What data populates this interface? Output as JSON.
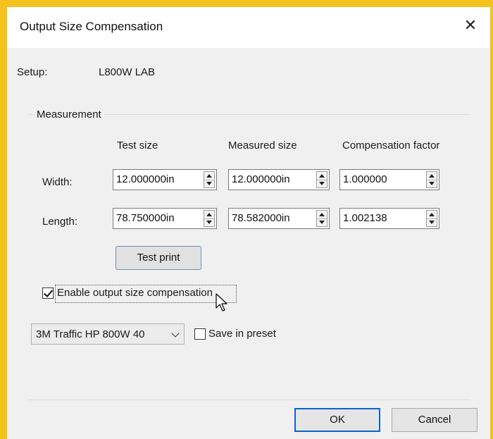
{
  "dialog": {
    "title": "Output Size Compensation",
    "close_glyph": "✕"
  },
  "setup": {
    "label": "Setup:",
    "value": "L800W LAB"
  },
  "measurement": {
    "group_label": "Measurement",
    "columns": [
      "Test size",
      "Measured size",
      "Compensation factor"
    ],
    "rows": [
      {
        "label": "Width:",
        "test_size": "12.000000in",
        "measured_size": "12.000000in",
        "factor": "1.000000"
      },
      {
        "label": "Length:",
        "test_size": "78.750000in",
        "measured_size": "78.582000in",
        "factor": "1.002138"
      }
    ],
    "test_print_label": "Test print"
  },
  "enable_compensation": {
    "label": "Enable output size compensation",
    "checked": true
  },
  "preset": {
    "selected": "3M Traffic HP 800W 40",
    "save_label": "Save in preset",
    "save_checked": false
  },
  "footer": {
    "ok_label": "OK",
    "cancel_label": "Cancel"
  },
  "colors": {
    "frame": "#f3c21c",
    "dialog_bg": "#f0f0f0",
    "focus_border": "#0a64c8"
  },
  "icons": {
    "close": "close-icon",
    "spin_up": "arrow-up-icon",
    "spin_down": "arrow-down-icon",
    "dropdown": "chevron-down-icon",
    "cursor": "mouse-pointer-icon"
  }
}
